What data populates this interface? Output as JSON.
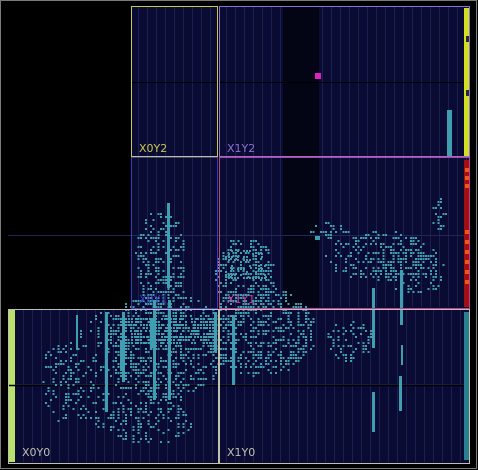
{
  "app": {
    "view": "device"
  },
  "colors": {
    "background": "#000000",
    "border": "#7a7a7a",
    "fabric": "#0a0b33",
    "fabric_grid": "#1c1f52",
    "cell": "#3f9fb0",
    "clock_region_x0y2": "#c8c850",
    "clock_region_x1y2": "#9070d0",
    "clock_region_x0y1": "#3c3cc0",
    "clock_region_x1y1": "#c040a0",
    "clock_region_x0y0": "#c0c0b0",
    "clock_region_x1y0": "#c0c0b0",
    "io_green": "#b8e06a",
    "io_yellow": "#d0e020",
    "io_red": "#a01010",
    "io_orange": "#f05a10",
    "highlight_magenta": "#e020c0",
    "io_teal": "#2a8090"
  },
  "clock_regions": [
    {
      "id": "x0y2",
      "label": "X0Y2"
    },
    {
      "id": "x1y2",
      "label": "X1Y2"
    },
    {
      "id": "x0y1",
      "label": "X0Y1"
    },
    {
      "id": "x1y1",
      "label": "X1Y1"
    },
    {
      "id": "x0y0",
      "label": "X0Y0"
    },
    {
      "id": "x1y0",
      "label": "X1Y0"
    }
  ]
}
